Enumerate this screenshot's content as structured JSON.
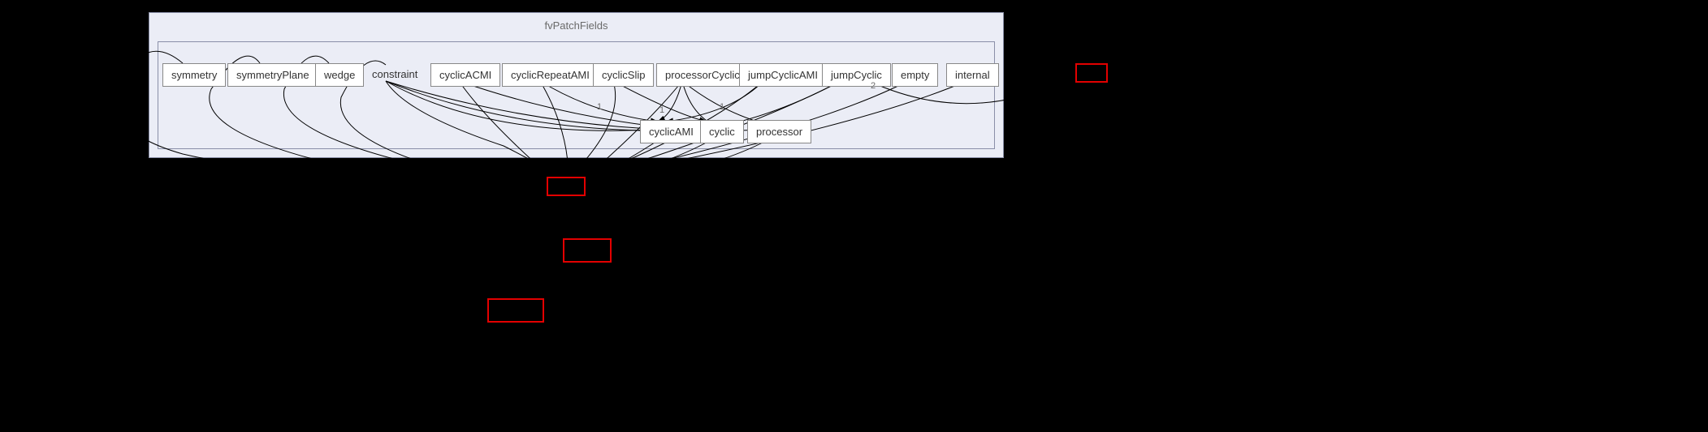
{
  "container": {
    "title": "fvPatchFields"
  },
  "nodes": {
    "symmetry": "symmetry",
    "symmetryPlane": "symmetryPlane",
    "wedge": "wedge",
    "constraint": "constraint",
    "cyclicACMI": "cyclicACMI",
    "cyclicRepeatAMI": "cyclicRepeatAMI",
    "cyclicSlip": "cyclicSlip",
    "processorCyclic": "processorCyclic",
    "jumpCyclicAMI": "jumpCyclicAMI",
    "jumpCyclic": "jumpCyclic",
    "empty": "empty",
    "internal": "internal",
    "cyclicAMI": "cyclicAMI",
    "cyclic": "cyclic",
    "processor": "processor"
  },
  "edgeLabels": {
    "edge1": "1",
    "edge2": "1",
    "edge3": "1",
    "edge4": "2"
  }
}
